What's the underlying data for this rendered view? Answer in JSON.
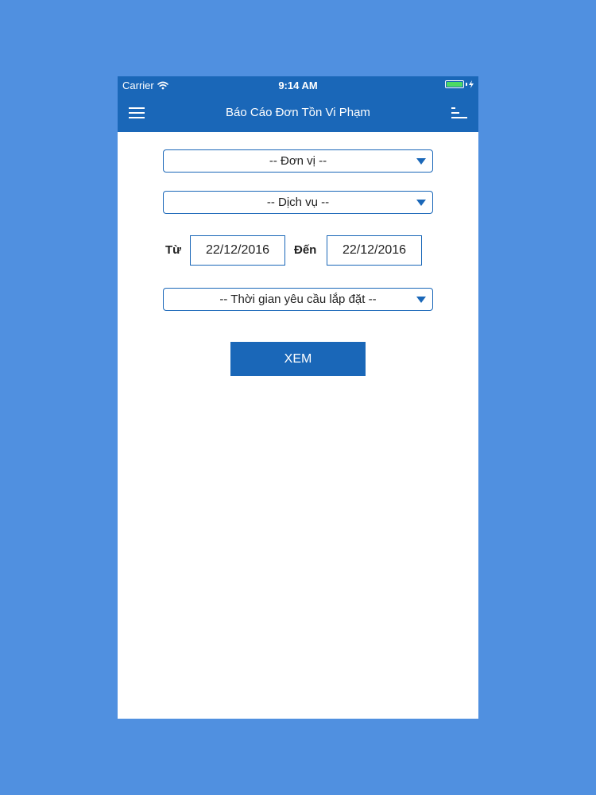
{
  "status_bar": {
    "carrier": "Carrier",
    "time": "9:14 AM",
    "battery_level": 1.0,
    "battery_color": "#4cd964"
  },
  "nav": {
    "title": "Báo Cáo Đơn Tồn Vi Phạm",
    "left_icon": "hamburger-menu-icon",
    "right_icon": "sort-icon",
    "background": "#1a67b8"
  },
  "form": {
    "unit_select": "-- Đơn vị --",
    "service_select": "-- Dịch vụ --",
    "from_label": "Từ",
    "from_date": "22/12/2016",
    "to_label": "Đến",
    "to_date": "22/12/2016",
    "install_time_select": "-- Thời gian yêu cầu lắp đặt --",
    "view_button": "XEM"
  },
  "colors": {
    "page_background": "#5090e0",
    "accent": "#1a67b8"
  }
}
